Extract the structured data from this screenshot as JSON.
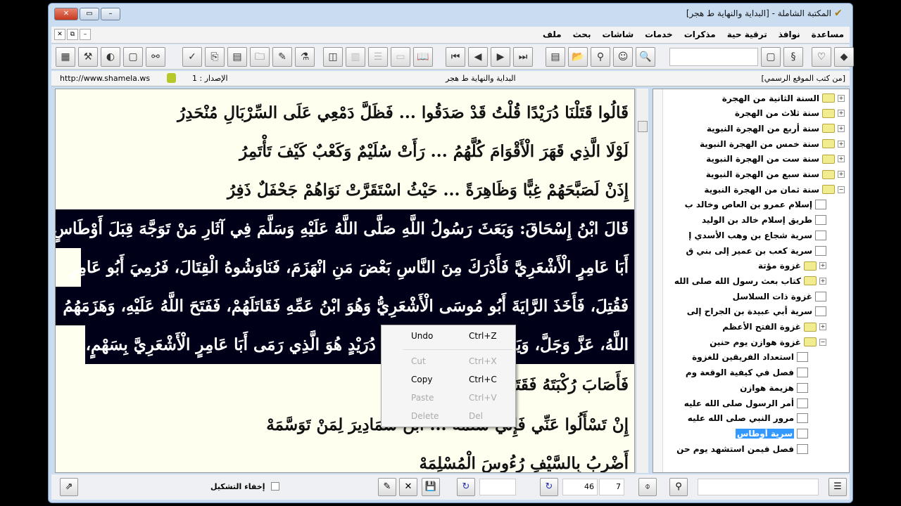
{
  "window": {
    "title": "المكتبة الشاملة - [البداية والنهاية ط هجر]"
  },
  "menu": [
    "ملف",
    "بحث",
    "شاشات",
    "خدمات",
    "مذكرات",
    "ترقية حية",
    "نوافذ",
    "مساعدة"
  ],
  "info": {
    "url": "http://www.shamela.ws",
    "version": "الإصدار : 1",
    "book": "البداية والنهاية ط هجر",
    "category": "[من كتب الموقع الرسمي]"
  },
  "content": {
    "lines": [
      "قَالُوا قَتَلْنَا دُرَيْدًا قُلْتُ قَدْ صَدَقُوا ... فَظَلَّ دَمْعِي عَلَى السِّرْبَالِ مُنْحَدِرُ",
      "لَوْلَا الَّذِي قَهَرَ الْأَقْوَامَ كُلَّهُمُ ... رَأَتْ سُلَيْمٌ وَكَعْبٌ كَيْفَ تَأْتَمِرُ",
      "إِذَنْ لَصَبَّحَهُمْ غِبًّا وَظَاهِرَةً ... حَيْثُ اسْتَقَرَّتْ نَوَاهُمْ جَحْفَلٌ ذَفِرُ",
      "قَالَ ابْنُ إِسْحَاقَ: وَبَعَثَ رَسُولُ اللَّهِ صَلَّى اللَّهُ عَلَيْهِ وَسَلَّمَ فِي آثَارِ مَنْ تَوَجَّهَ قِبَلَ أَوْطَاسٍ",
      "أَبَا عَامِرٍ الْأَشْعَرِيَّ فَأَدْرَكَ مِنَ النَّاسِ بَعْضَ مَنِ انْهَزَمَ، فَنَاوَشُوهُ الْقِتَالَ، فَرُمِيَ أَبُو عَامِرٍ",
      "فَقُتِلَ، فَأَخَذَ الرَّايَةَ أَبُو مُوسَى الْأَشْعَرِيُّ وَهُوَ ابْنُ عَمِّهِ فَقَاتَلَهُمْ، فَفَتَحَ اللَّهُ عَلَيْهِ، وَهَزَمَهُمُ",
      "اللَّهُ، عَزَّ وَجَلَّ، وَيَزْعُمُونَ أَنَّ سَلَمَةَ بْنَ دُرَيْدٍ هُوَ الَّذِي رَمَى أَبَا عَامِرٍ الْأَشْعَرِيَّ بِسَهْمٍ،",
      "فَأَصَابَ رُكْبَتَهُ فَقَتَلَهُ",
      "إِنْ تَسْأَلُوا عَنِّي فَإِنِّي سَلَمَهْ ... ابْنُ سَمَادِيرَ لِمَنْ تَوَسَّمَهْ",
      "أَضْرِبُ بِالسَّيْفِ رُءُوسَ الْمُسْلِمَهْ"
    ]
  },
  "context_menu": [
    {
      "label": "Undo",
      "shortcut": "Ctrl+Z",
      "enabled": true
    },
    {
      "label": "Cut",
      "shortcut": "Ctrl+X",
      "enabled": false
    },
    {
      "label": "Copy",
      "shortcut": "Ctrl+C",
      "enabled": true
    },
    {
      "label": "Paste",
      "shortcut": "Ctrl+V",
      "enabled": false
    },
    {
      "label": "Delete",
      "shortcut": "Del",
      "enabled": false
    }
  ],
  "tree": [
    {
      "label": "السنة الثانية من الهجرة",
      "type": "folder",
      "level": 0
    },
    {
      "label": "سنة ثلاث من الهجرة",
      "type": "folder",
      "level": 0
    },
    {
      "label": "سنة أربع من الهجرة النبوية",
      "type": "folder",
      "level": 0
    },
    {
      "label": "سنة خمس من الهجرة النبوية",
      "type": "folder",
      "level": 0
    },
    {
      "label": "سنة ست من الهجرة النبوية",
      "type": "folder",
      "level": 0
    },
    {
      "label": "سنة سبع من الهجرة النبوية",
      "type": "folder",
      "level": 0
    },
    {
      "label": "سنة ثمان من الهجرة النبوية",
      "type": "open",
      "level": 0
    },
    {
      "label": "إسلام عمرو بن العاص وخالد ب",
      "type": "page",
      "level": 1
    },
    {
      "label": "طريق إسلام خالد بن الوليد",
      "type": "page",
      "level": 1
    },
    {
      "label": "سرية شجاع بن وهب الأسدي إ",
      "type": "page",
      "level": 1
    },
    {
      "label": "سرية كعب بن عمير إلى بني ق",
      "type": "page",
      "level": 1
    },
    {
      "label": "غزوة مؤتة",
      "type": "folder",
      "level": 1
    },
    {
      "label": "كتاب بعث رسول الله صلى الله",
      "type": "folder",
      "level": 1
    },
    {
      "label": "غزوة ذات السلاسل",
      "type": "page",
      "level": 1
    },
    {
      "label": "سرية أبي عبيدة بن الجراح إلى",
      "type": "page",
      "level": 1
    },
    {
      "label": "غزوة الفتح الأعظم",
      "type": "folder",
      "level": 1
    },
    {
      "label": "غزوة هوازن يوم حنين",
      "type": "open",
      "level": 1
    },
    {
      "label": "استعداد الفريقين للغزوة",
      "type": "page",
      "level": 2
    },
    {
      "label": "فصل في كيفية الوقعة وم",
      "type": "page",
      "level": 2
    },
    {
      "label": "هزيمة هوازن",
      "type": "page",
      "level": 2
    },
    {
      "label": "أمر الرسول صلى الله عليه",
      "type": "page",
      "level": 2
    },
    {
      "label": "مرور النبي صلى الله عليه",
      "type": "page",
      "level": 2
    },
    {
      "label": "سرية أوطاس",
      "type": "page",
      "level": 2,
      "selected": true
    },
    {
      "label": "فصل فيمن استشهد يوم حن",
      "type": "page",
      "level": 2
    }
  ],
  "bottom": {
    "hide_diacritics": "إخفاء التشكيل",
    "page": "46",
    "part": "7"
  }
}
